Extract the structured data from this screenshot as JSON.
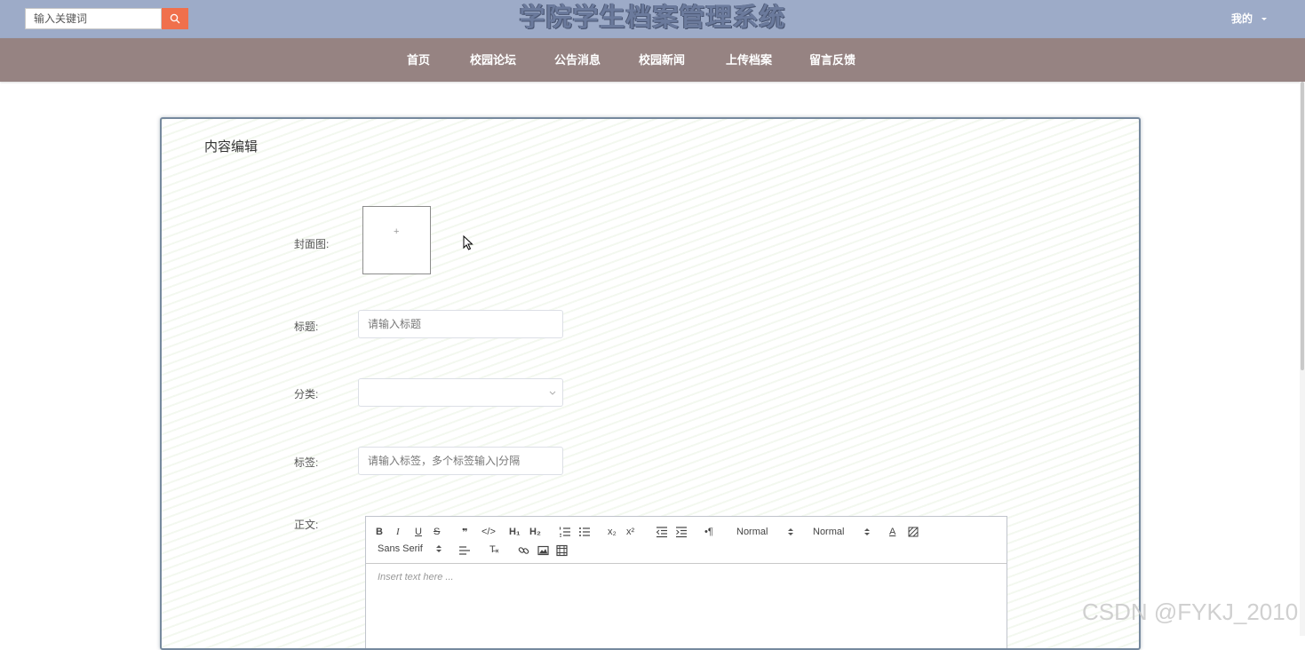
{
  "header": {
    "search_placeholder": "输入关键词",
    "title": "学院学生档案管理系统",
    "user_menu_label": "我的"
  },
  "nav": {
    "items": [
      "首页",
      "校园论坛",
      "公告消息",
      "校园新闻",
      "上传档案",
      "留言反馈"
    ]
  },
  "form": {
    "section_title": "内容编辑",
    "cover_label": "封面图:",
    "cover_plus": "+",
    "title_label": "标题:",
    "title_placeholder": "请输入标题",
    "category_label": "分类:",
    "category_value": "",
    "tags_label": "标签:",
    "tags_placeholder": "请输入标签，多个标签输入|分隔",
    "body_label": "正文:"
  },
  "editor": {
    "header_select": "Normal",
    "size_select": "Normal",
    "font_select": "Sans Serif",
    "placeholder": "Insert text here ..."
  },
  "watermark": "CSDN @FYKJ_2010",
  "colors": {
    "topbar": "#9dabc8",
    "navbar": "#968382",
    "search_button": "#f0704c",
    "card_border": "#76899e"
  }
}
